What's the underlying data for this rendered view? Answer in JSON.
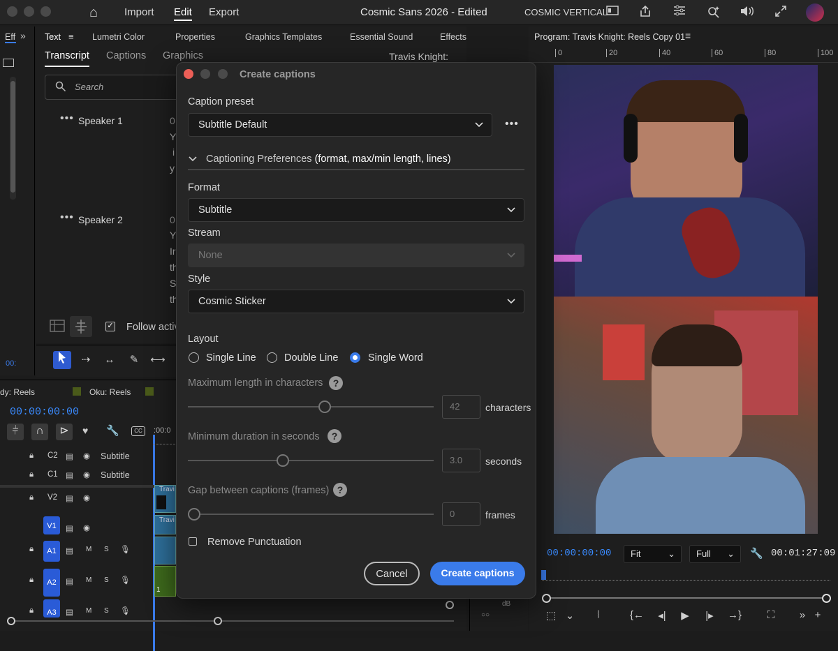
{
  "topbar": {
    "menu": [
      "Import",
      "Edit",
      "Export"
    ],
    "title": "Cosmic Sans 2026 - Edited",
    "workspace": "COSMIC VERTICAL"
  },
  "left": {
    "strip_label": "Eff",
    "panel_tabs": [
      "Text",
      "Lumetri Color",
      "Properties",
      "Graphics Templates",
      "Essential Sound",
      "Effects"
    ],
    "sub_tabs": [
      "Transcript",
      "Captions",
      "Graphics"
    ],
    "sequence_name": "Travis Knight: Reels Copy 01",
    "search_placeholder": "Search",
    "speakers": [
      {
        "name": "Speaker 1",
        "time": "0",
        "lines": [
          "Y",
          "i",
          "y"
        ]
      },
      {
        "name": "Speaker 2",
        "time": "0",
        "lines": [
          "Y",
          "Ir",
          "th",
          "S",
          "th"
        ]
      }
    ],
    "follow_label": "Follow activ",
    "strip_timecode": "00:"
  },
  "timeline": {
    "tabs": [
      "dy: Reels",
      "Oku: Reels"
    ],
    "timecode": "00:00:00:00",
    "ruler_start": ":00:0",
    "tracks": [
      {
        "id": "C2",
        "name": "Subtitle"
      },
      {
        "id": "C1",
        "name": "Subtitle"
      },
      {
        "id": "V2",
        "name": ""
      },
      {
        "id": "V1",
        "name": ""
      },
      {
        "id": "A1",
        "name": ""
      },
      {
        "id": "A2",
        "name": ""
      },
      {
        "id": "A3",
        "name": ""
      }
    ],
    "ms": [
      "M",
      "S"
    ],
    "clip_labels": [
      "Travi",
      "Travi",
      "1"
    ],
    "meter_unit": "dB"
  },
  "program": {
    "title": "Program: Travis Knight: Reels Copy 01",
    "ruler": [
      "0",
      "20",
      "40",
      "60",
      "80",
      "100"
    ],
    "timecode_in": "00:00:00:00",
    "fit": "Fit",
    "quality": "Full",
    "duration": "00:01:27:09"
  },
  "dialog": {
    "title": "Create captions",
    "preset_label": "Caption preset",
    "preset_value": "Subtitle Default",
    "prefs_label": "Captioning Preferences",
    "prefs_detail": "(format, max/min length, lines)",
    "format_label": "Format",
    "format_value": "Subtitle",
    "stream_label": "Stream",
    "stream_value": "None",
    "style_label": "Style",
    "style_value": "Cosmic Sticker",
    "layout_label": "Layout",
    "layout_options": [
      "Single Line",
      "Double Line",
      "Single Word"
    ],
    "layout_selected": "Single Word",
    "max_len_label": "Maximum length in characters",
    "max_len_value": "42",
    "max_len_unit": "characters",
    "max_len_fraction": 0.56,
    "min_dur_label": "Minimum duration in seconds",
    "min_dur_value": "3.0",
    "min_dur_unit": "seconds",
    "min_dur_fraction": 0.38,
    "gap_label": "Gap between captions (frames)",
    "gap_value": "0",
    "gap_unit": "frames",
    "gap_fraction": 0.0,
    "remove_punct_label": "Remove Punctuation",
    "remove_punct_checked": false,
    "cancel_label": "Cancel",
    "create_label": "Create captions"
  },
  "colors": {
    "accent": "#3a7bea",
    "close": "#ec5f57",
    "badge": "#2a5bd7"
  }
}
